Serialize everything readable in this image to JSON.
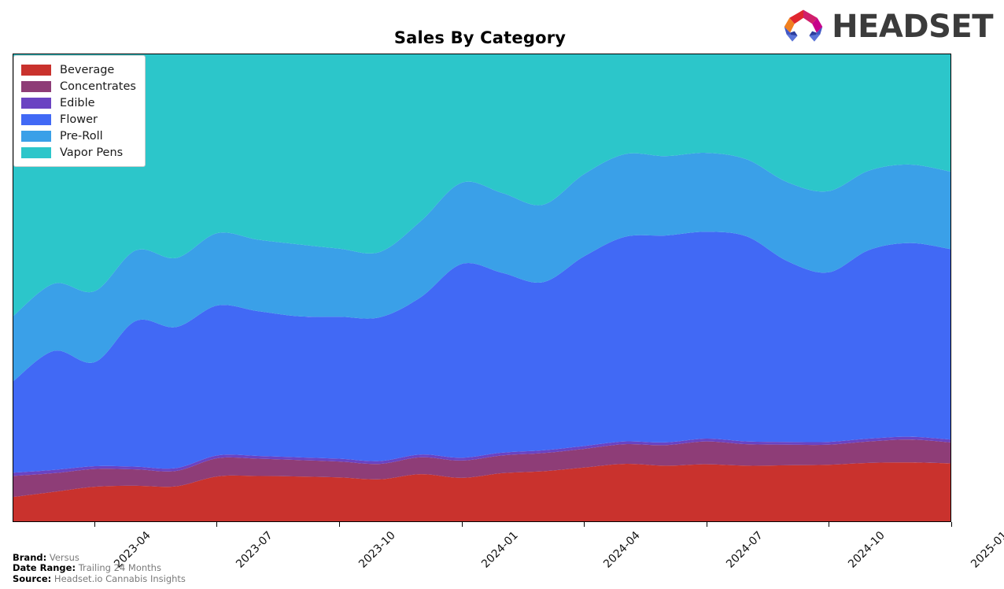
{
  "header": {
    "title": "Sales By Category",
    "logo_word": "HEADSET",
    "logo_mark_name": "headset-arch-logo"
  },
  "legend": {
    "position": "upper-left",
    "items": [
      {
        "label": "Beverage",
        "color": "#c9322d"
      },
      {
        "label": "Concentrates",
        "color": "#8e3d77"
      },
      {
        "label": "Edible",
        "color": "#6b43c2"
      },
      {
        "label": "Flower",
        "color": "#4169f5"
      },
      {
        "label": "Pre-Roll",
        "color": "#3aa0e8"
      },
      {
        "label": "Vapor Pens",
        "color": "#2cc6ca"
      }
    ]
  },
  "footer": {
    "rows": [
      {
        "key": "Brand:",
        "value": "Versus"
      },
      {
        "key": "Date Range:",
        "value": "Trailing 24 Months"
      },
      {
        "key": "Source:",
        "value": "Headset.io Cannabis Insights"
      }
    ]
  },
  "chart_data": {
    "type": "area",
    "stacked": true,
    "title": "Sales By Category",
    "xlabel": "",
    "ylabel": "",
    "grid": false,
    "legend_position": "upper left",
    "smoothing": "spline",
    "ylim": [
      0,
      100
    ],
    "x": [
      "2023-02",
      "2023-03",
      "2023-04",
      "2023-05",
      "2023-06",
      "2023-07",
      "2023-08",
      "2023-09",
      "2023-10",
      "2023-11",
      "2023-12",
      "2024-01",
      "2024-02",
      "2024-03",
      "2024-04",
      "2024-05",
      "2024-06",
      "2024-07",
      "2024-08",
      "2024-09",
      "2024-10",
      "2024-11",
      "2024-12",
      "2025-01"
    ],
    "x_tick_labels": [
      "2023-04",
      "2023-07",
      "2023-10",
      "2024-01",
      "2024-04",
      "2024-07",
      "2024-10",
      "2025-01"
    ],
    "x_tick_positions": [
      2,
      5,
      8,
      11,
      14,
      17,
      20,
      23
    ],
    "series": [
      {
        "name": "Beverage",
        "color": "#c9322d",
        "values": [
          5.2,
          6.3,
          7.4,
          7.6,
          7.5,
          9.6,
          9.7,
          9.6,
          9.4,
          9.0,
          10.1,
          9.3,
          10.3,
          10.7,
          11.5,
          12.3,
          11.9,
          12.2,
          11.9,
          12.0,
          12.1,
          12.5,
          12.6,
          12.4
        ]
      },
      {
        "name": "Concentrates",
        "color": "#8e3d77",
        "values": [
          4.5,
          4.0,
          3.8,
          3.5,
          3.3,
          3.9,
          3.7,
          3.5,
          3.4,
          3.3,
          3.6,
          3.7,
          3.8,
          3.9,
          4.0,
          4.2,
          4.4,
          4.9,
          4.6,
          4.4,
          4.3,
          4.6,
          4.9,
          4.5
        ]
      },
      {
        "name": "Edible",
        "color": "#6b43c2",
        "values": [
          0.7,
          0.7,
          0.6,
          0.6,
          0.6,
          0.6,
          0.6,
          0.6,
          0.6,
          0.6,
          0.6,
          0.6,
          0.6,
          0.6,
          0.6,
          0.6,
          0.6,
          0.6,
          0.6,
          0.6,
          0.6,
          0.6,
          0.6,
          0.6
        ]
      },
      {
        "name": "Flower",
        "color": "#4169f5",
        "values": [
          19.6,
          25.5,
          22.3,
          31.2,
          30.2,
          32.1,
          31.0,
          30.2,
          30.4,
          30.8,
          33.7,
          41.5,
          38.5,
          36.0,
          40.6,
          43.8,
          44.3,
          44.3,
          43.9,
          38.7,
          36.3,
          40.4,
          41.5,
          40.8
        ]
      },
      {
        "name": "Pre-Roll",
        "color": "#3aa0e8",
        "values": [
          14.0,
          14.4,
          15.2,
          15.1,
          14.8,
          15.5,
          15.3,
          15.4,
          14.6,
          14.0,
          16.3,
          17.4,
          17.1,
          16.6,
          17.6,
          17.7,
          17.0,
          16.9,
          16.5,
          16.9,
          17.4,
          17.0,
          16.8,
          16.6
        ]
      },
      {
        "name": "Vapor Pens",
        "color": "#2cc6ca",
        "values": [
          56.0,
          49.1,
          50.7,
          42.0,
          43.6,
          38.3,
          39.7,
          40.7,
          41.6,
          42.3,
          35.7,
          27.5,
          29.7,
          32.2,
          25.7,
          21.4,
          21.8,
          21.1,
          22.5,
          27.4,
          29.3,
          24.9,
          23.6,
          25.1
        ]
      }
    ]
  }
}
